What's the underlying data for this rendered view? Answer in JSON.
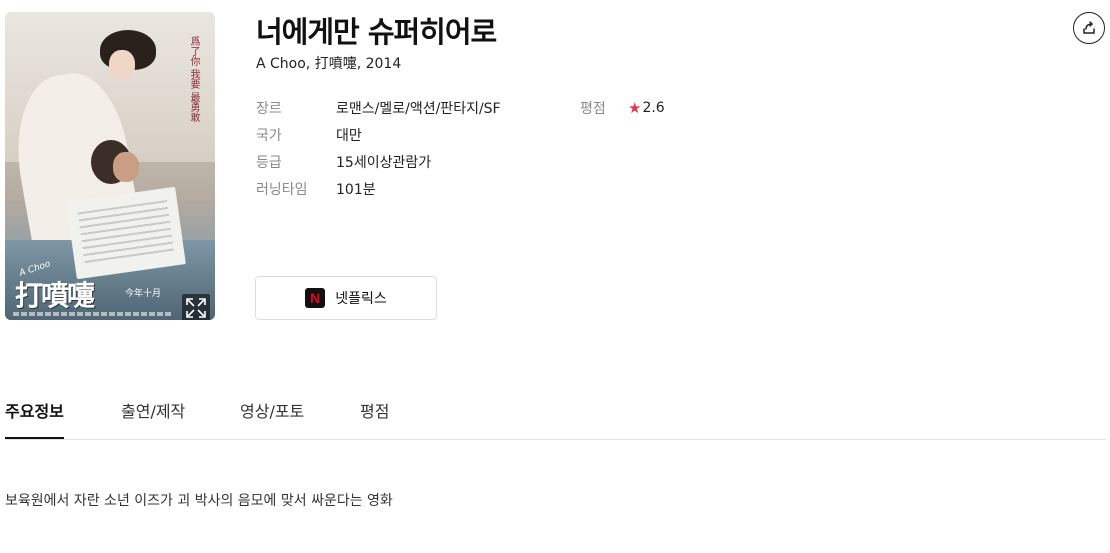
{
  "movie": {
    "title": "너에게만 슈퍼히어로",
    "subtitle": "A Choo, 打噴嚏, 2014",
    "poster": {
      "title_art": "打噴嚏",
      "title_en": "A Choo",
      "vertical_text": "爲了你 我要 最勇敢",
      "date_text": "今年十月"
    },
    "info": [
      {
        "label": "장르",
        "value": "로맨스/멜로/액션/판타지/SF"
      },
      {
        "label": "국가",
        "value": "대만"
      },
      {
        "label": "등급",
        "value": "15세이상관람가"
      },
      {
        "label": "러닝타임",
        "value": "101분"
      }
    ],
    "rating": {
      "label": "평점",
      "star": "★",
      "value": "2.6"
    }
  },
  "streaming": {
    "label": "넷플릭스",
    "logo_letter": "N",
    "logo_color": "#e50914"
  },
  "icons": {
    "share": "share-icon",
    "expand": "expand-icon"
  },
  "tabs": [
    {
      "label": "주요정보",
      "active": true
    },
    {
      "label": "출연/제작",
      "active": false
    },
    {
      "label": "영상/포토",
      "active": false
    },
    {
      "label": "평점",
      "active": false
    }
  ],
  "synopsis": "보육원에서 자란 소년 이즈가 괴 박사의 음모에 맞서 싸운다는 영화"
}
